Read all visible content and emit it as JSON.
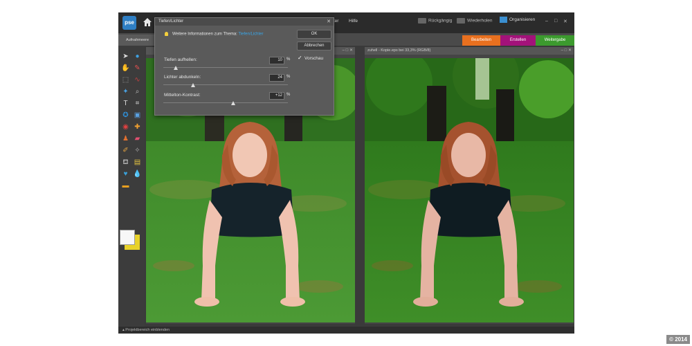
{
  "app": {
    "logo_text": "pse",
    "menu": [
      "nster",
      "Hilfe"
    ],
    "undo_label": "Rückgängig",
    "redo_label": "Wiederholen",
    "organize_label": "Organisieren",
    "window_controls": [
      "–",
      "□",
      "✕"
    ]
  },
  "tabs": {
    "record_tab": "Aufnahmeere",
    "panel_tabs": [
      {
        "label": "Bearbeiten",
        "color": "#e8701f"
      },
      {
        "label": "Erstellen",
        "color": "#a3127a"
      },
      {
        "label": "Weitergabe",
        "color": "#3c9a2e"
      }
    ]
  },
  "documents": {
    "left": {
      "title": ""
    },
    "right": {
      "title": "zuhell - Kopie.eps bei 33,3% (RGB/8)"
    }
  },
  "status": {
    "project_area_label": "Projektbereich einblenden"
  },
  "dialog": {
    "title": "Tiefen/Lichter",
    "info_text": "Weitere Informationen zum Thema:",
    "info_link": "Tiefen/Lichter",
    "ok_label": "OK",
    "cancel_label": "Abbrechen",
    "preview_label": "Vorschau",
    "preview_checked": true,
    "params": [
      {
        "label": "Tiefen aufhellen:",
        "value": "10",
        "unit": "%",
        "slider_fraction": 0.1
      },
      {
        "label": "Lichter abdunkeln:",
        "value": "24",
        "unit": "%",
        "slider_fraction": 0.24
      },
      {
        "label": "Mittelton-Kontrast:",
        "value": "+12",
        "unit": "%",
        "slider_fraction": 0.56
      }
    ]
  },
  "copyright": "© 2014",
  "colors": {
    "accent_blue": "#2f7fc4",
    "foreground_swatch": "#f7f7f7",
    "background_swatch": "#e8d22a"
  }
}
